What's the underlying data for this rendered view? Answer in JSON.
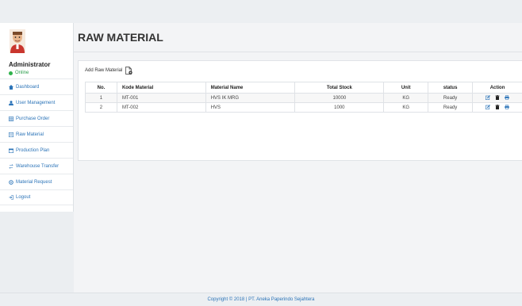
{
  "sidebar": {
    "user_name": "Administrator",
    "user_status": "Online",
    "items": [
      {
        "label": "Dashboard"
      },
      {
        "label": "User Management"
      },
      {
        "label": "Purchase Order"
      },
      {
        "label": "Raw Material"
      },
      {
        "label": "Production Plan"
      },
      {
        "label": "Warehouse Transfer"
      },
      {
        "label": "Material Request"
      },
      {
        "label": "Logout"
      }
    ]
  },
  "main": {
    "title": "RAW MATERIAL",
    "add_label": "Add Raw Material",
    "table": {
      "headers": [
        "No.",
        "Kode Material",
        "Material Name",
        "Total Stock",
        "Unit",
        "status",
        "Action"
      ],
      "rows": [
        {
          "no": "1",
          "kode": "MT-001",
          "name": "HVS IK MRG",
          "stock": "10000",
          "unit": "KG",
          "status": "Ready"
        },
        {
          "no": "2",
          "kode": "MT-002",
          "name": "HVS",
          "stock": "1000",
          "unit": "KG",
          "status": "Ready"
        }
      ]
    }
  },
  "footer": {
    "copyright": "Copyright © 2018 | PT. Aneka Paperindo Sejahtera"
  },
  "colors": {
    "link": "#2c74b8",
    "online": "#2fb34b"
  }
}
